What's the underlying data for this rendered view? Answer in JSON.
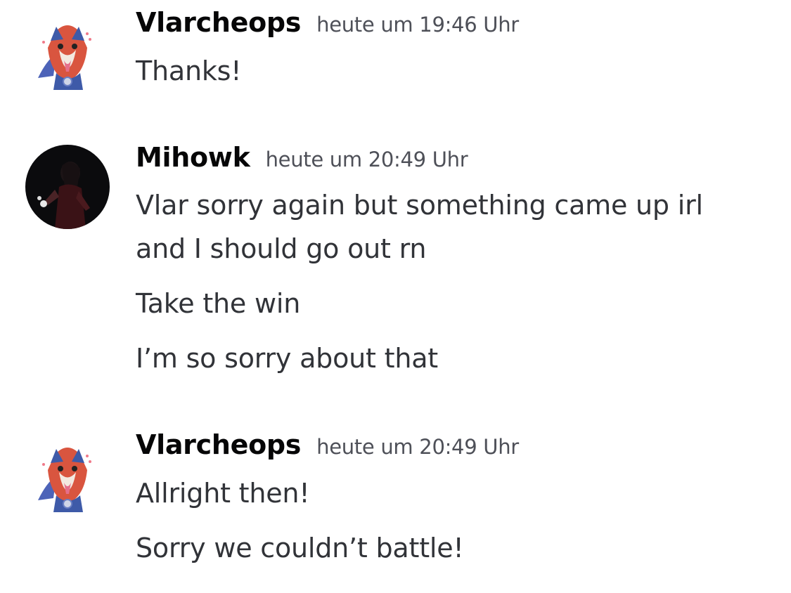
{
  "messages": [
    {
      "author": "Vlarcheops",
      "timestamp": "heute um 19:46 Uhr",
      "avatar_icon": "wolf-pokemon-avatar-icon",
      "lines": [
        "Thanks!"
      ]
    },
    {
      "author": "Mihowk",
      "timestamp": "heute um 20:49 Uhr",
      "avatar_icon": "dark-figure-avatar-icon",
      "lines": [
        "Vlar sorry again but something came up irl",
        "and I should go out rn",
        "Take the win",
        "I’m so sorry about that"
      ]
    },
    {
      "author": "Vlarcheops",
      "timestamp": "heute um 20:49 Uhr",
      "avatar_icon": "wolf-pokemon-avatar-icon",
      "lines": [
        "Allright then!",
        "Sorry we couldn’t battle!"
      ]
    }
  ],
  "colors": {
    "username": "#060607",
    "timestamp": "#4e5058",
    "text": "#313338",
    "background": "#ffffff"
  }
}
